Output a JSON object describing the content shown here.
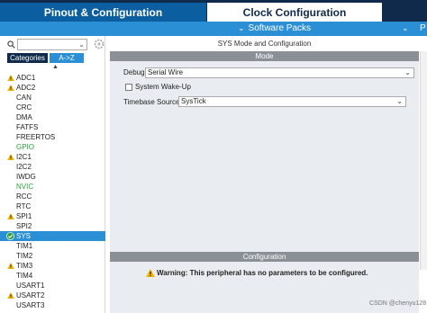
{
  "tabs": {
    "pinout": "Pinout & Configuration",
    "clock": "Clock Configuration"
  },
  "subbar": {
    "software_packs": "Software Packs"
  },
  "sidebar": {
    "search_placeholder": "",
    "category_tabs": [
      "Categories",
      "A->Z"
    ],
    "items": [
      {
        "label": "ADC1",
        "status": "warning"
      },
      {
        "label": "ADC2",
        "status": "warning"
      },
      {
        "label": "CAN",
        "status": "none"
      },
      {
        "label": "CRC",
        "status": "none"
      },
      {
        "label": "DMA",
        "status": "none"
      },
      {
        "label": "FATFS",
        "status": "none"
      },
      {
        "label": "FREERTOS",
        "status": "none"
      },
      {
        "label": "GPIO",
        "status": "green"
      },
      {
        "label": "I2C1",
        "status": "warning"
      },
      {
        "label": "I2C2",
        "status": "none"
      },
      {
        "label": "IWDG",
        "status": "none"
      },
      {
        "label": "NVIC",
        "status": "green"
      },
      {
        "label": "RCC",
        "status": "none"
      },
      {
        "label": "RTC",
        "status": "none"
      },
      {
        "label": "SPI1",
        "status": "warning"
      },
      {
        "label": "SPI2",
        "status": "none"
      },
      {
        "label": "SYS",
        "status": "selected-check"
      },
      {
        "label": "TIM1",
        "status": "none"
      },
      {
        "label": "TIM2",
        "status": "none"
      },
      {
        "label": "TIM3",
        "status": "warning"
      },
      {
        "label": "TIM4",
        "status": "none"
      },
      {
        "label": "USART1",
        "status": "none"
      },
      {
        "label": "USART2",
        "status": "warning"
      },
      {
        "label": "USART3",
        "status": "none"
      }
    ]
  },
  "panel": {
    "title": "SYS Mode and Configuration",
    "mode_header": "Mode",
    "debug_label": "Debug",
    "debug_value": "Serial Wire",
    "wakeup_label": "System Wake-Up",
    "timebase_label": "Timebase Source",
    "timebase_value": "SysTick",
    "config_header": "Configuration",
    "warning_text": "Warning: This peripheral has no parameters to be configured."
  },
  "watermark": "CSDN @chenyu128",
  "colors": {
    "accent": "#2b8fd6",
    "dark": "#0f2a4a",
    "warning": "#f2b400",
    "green": "#2aa23a"
  }
}
